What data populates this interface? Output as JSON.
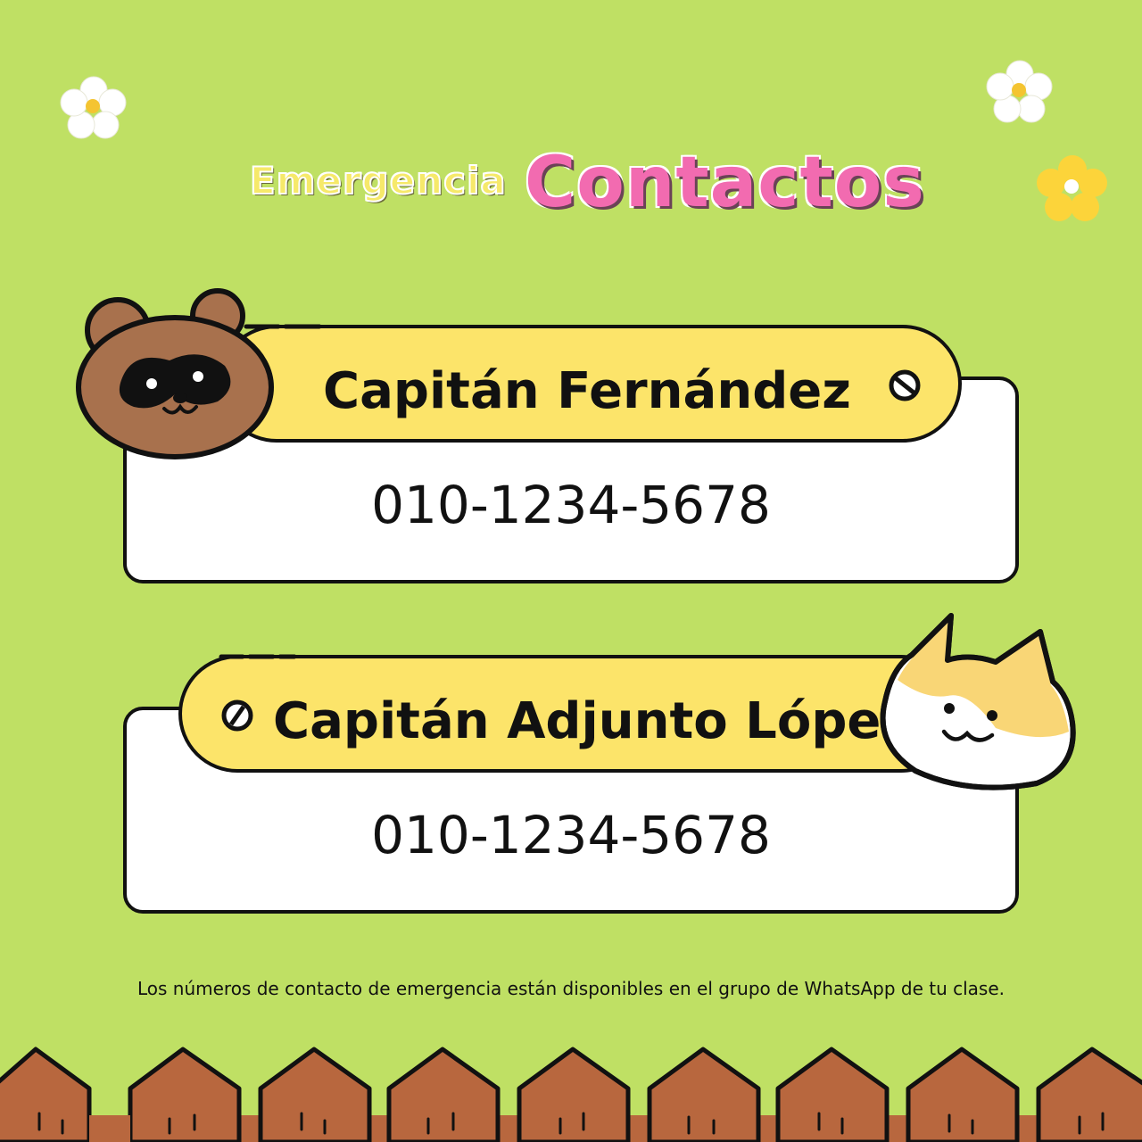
{
  "title": {
    "part1": "Emergencia",
    "part2": "Contactos"
  },
  "contacts": [
    {
      "name": "Capitán Fernández",
      "phone": "010-1234-5678"
    },
    {
      "name": "Capitán Adjunto López",
      "phone": "010-1234-5678"
    }
  ],
  "footer": "Los números de contacto de emergencia están disponibles en el grupo de WhatsApp de tu clase.",
  "colors": {
    "background": "#bfe064",
    "tag": "#fce46a",
    "title_pink": "#f26bb0",
    "title_yellow": "#f6e96a",
    "fence": "#b8673e"
  },
  "icons": [
    "flower-icon",
    "raccoon-icon",
    "cat-icon",
    "no-sign-icon",
    "fence"
  ]
}
